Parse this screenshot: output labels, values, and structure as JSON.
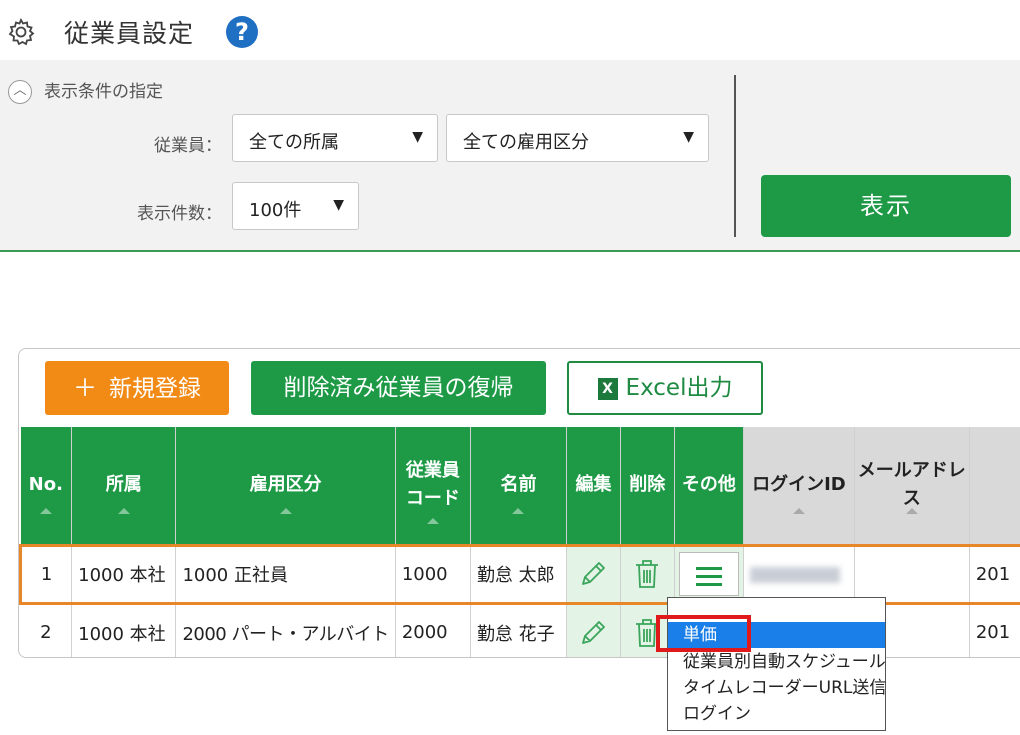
{
  "header": {
    "title": "従業員設定",
    "help": "?"
  },
  "filters": {
    "condition_label": "表示条件の指定",
    "employee_label": "従業員：",
    "dept_value": "全ての所属",
    "employment_value": "全ての雇用区分",
    "count_label": "表示件数：",
    "count_value": "100件",
    "show_button": "表示"
  },
  "toolbar": {
    "new_label": "新規登録",
    "restore_label": "削除済み従業員の復帰",
    "excel_label": "Excel出力"
  },
  "table": {
    "headers": {
      "no": "No.",
      "dept": "所属",
      "employment": "雇用区分",
      "code_line1": "従業員",
      "code_line2": "コード",
      "name": "名前",
      "edit": "編集",
      "delete": "削除",
      "other": "その他",
      "login_id": "ログインID",
      "email": "メールアドレス"
    },
    "rows": [
      {
        "no": "1",
        "dept": "1000 本社",
        "employment": "1000 正社員",
        "code": "1000",
        "name": "勤怠 太郎",
        "extra": "201"
      },
      {
        "no": "2",
        "dept": "1000 本社",
        "employment": "2000 パート・アルバイト",
        "code": "2000",
        "name": "勤怠 花子",
        "extra": "201"
      }
    ]
  },
  "dropdown": {
    "items": [
      "単価",
      "従業員別自動スケジュール",
      "タイムレコーダーURL送信",
      "ログイン"
    ]
  },
  "colors": {
    "green": "#1e9a47",
    "orange": "#f28a16",
    "highlight": "#1a7fe8",
    "red": "#e01a1a"
  }
}
